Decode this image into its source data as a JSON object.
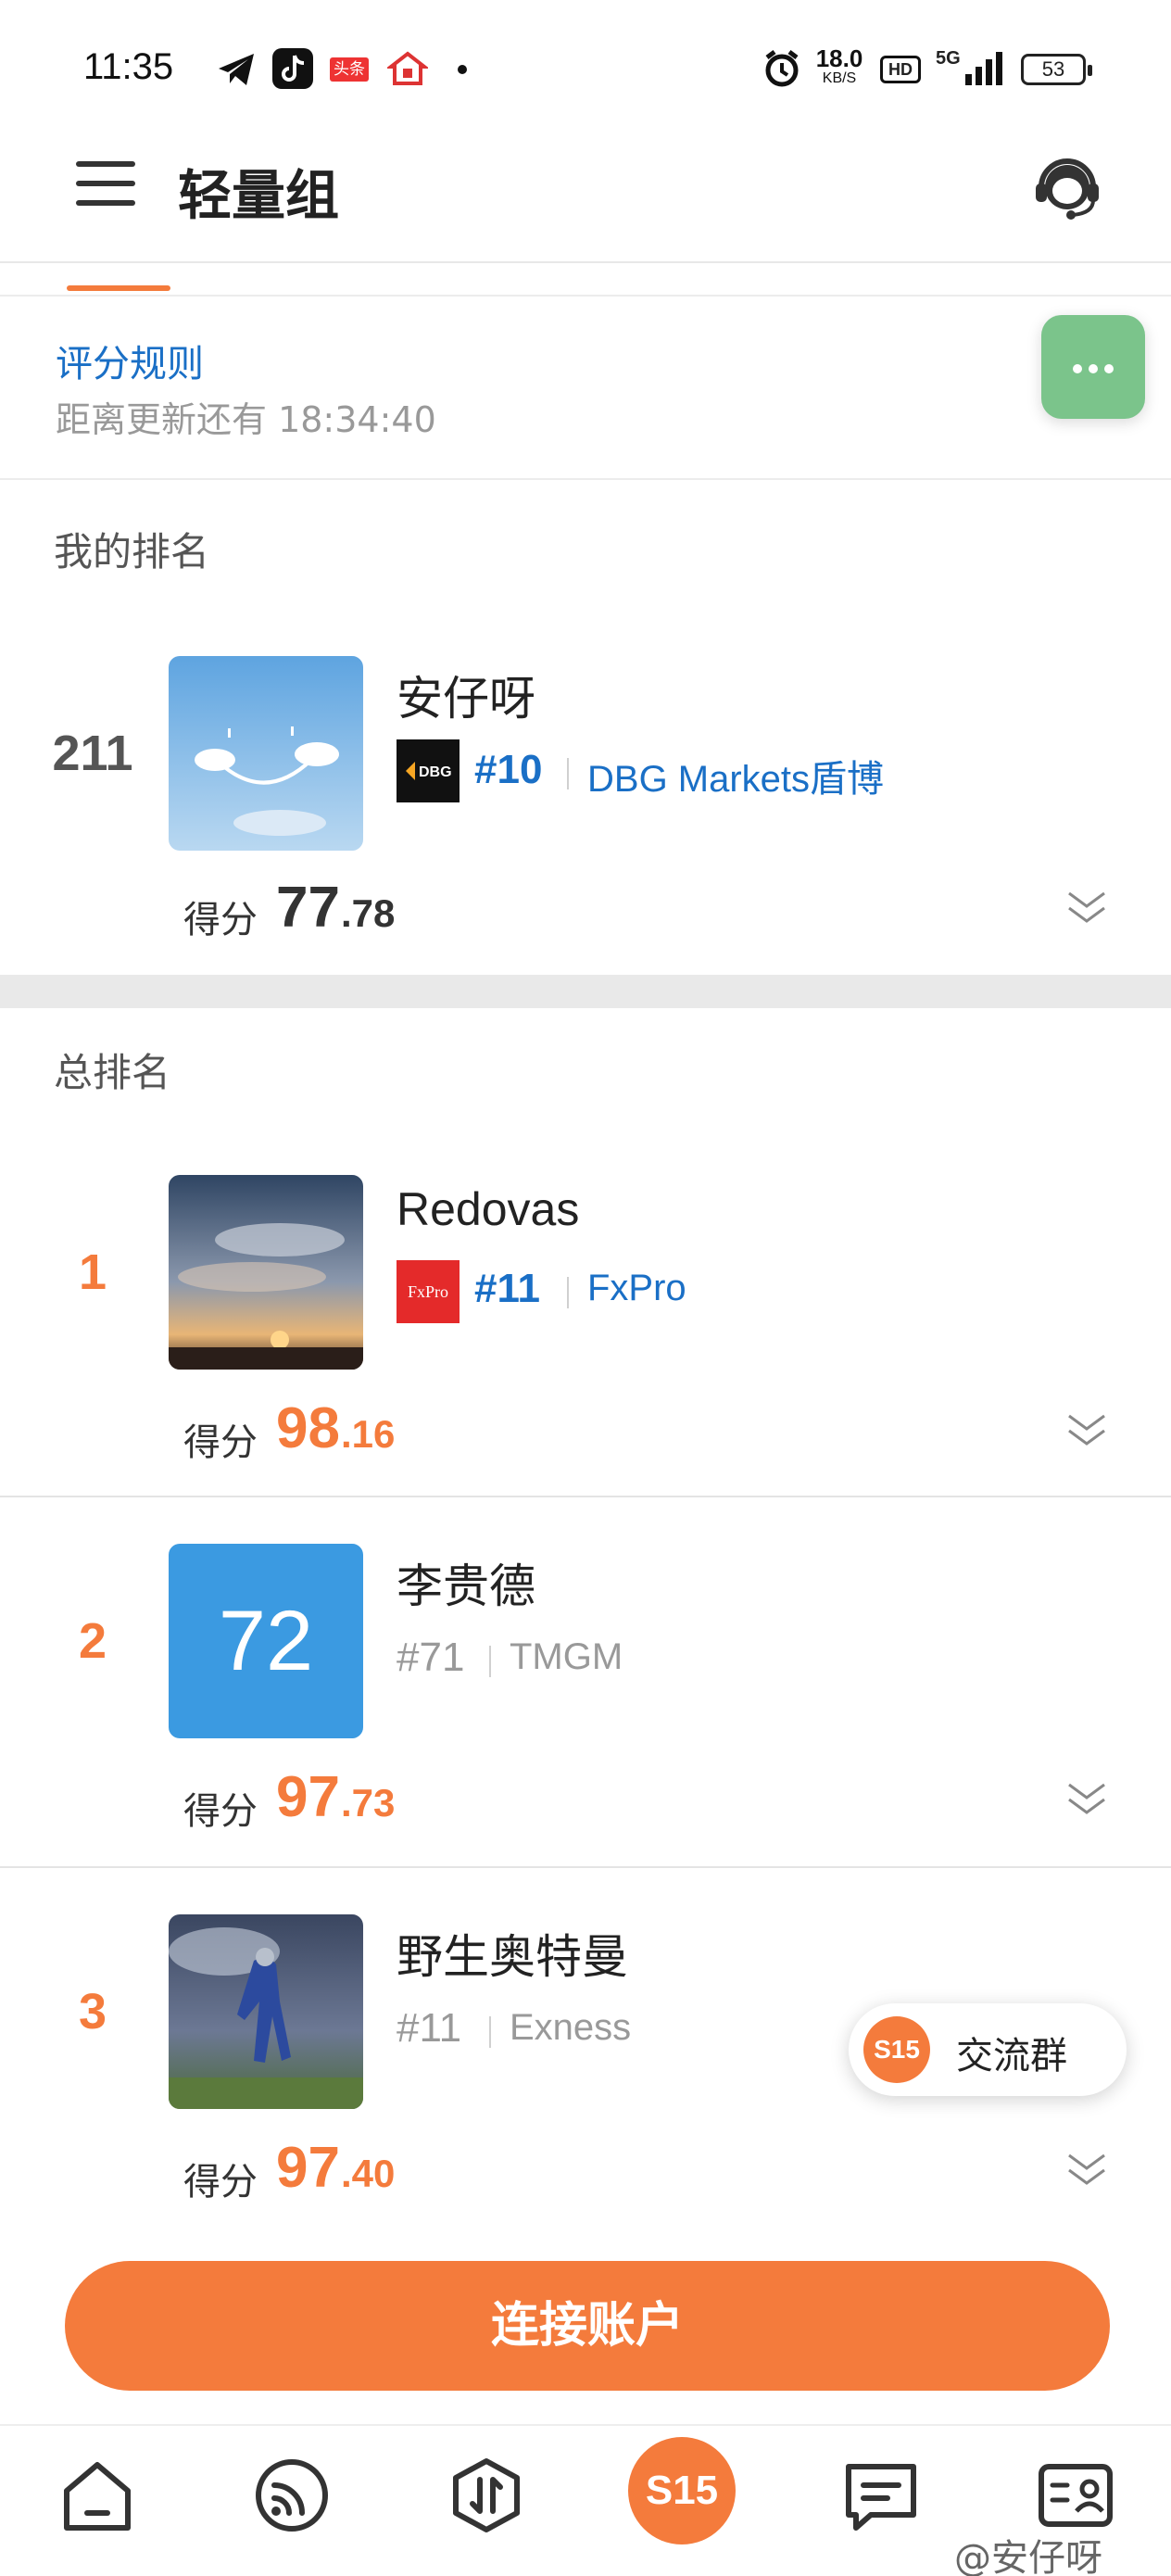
{
  "status_bar": {
    "time": "11:35",
    "notif_toutiao": "头条",
    "net_speed": "18.0",
    "net_unit": "KB/S",
    "hd_label": "HD",
    "signal_label": "5G",
    "battery": "53"
  },
  "header": {
    "title": "轻量组",
    "menu_icon": "hamburger-menu-icon",
    "support_icon": "customer-service-icon"
  },
  "rules": {
    "link_label": "评分规则",
    "countdown": "距离更新还有 18:34:40"
  },
  "my_rank": {
    "section_title": "我的排名",
    "rank": "211",
    "name": "安仔呀",
    "broker_rank": "#10",
    "broker_name": "DBG Markets盾博",
    "score_label": "得分",
    "score_int": "77",
    "score_dec": ".78"
  },
  "overall": {
    "section_title": "总排名",
    "rows": [
      {
        "rank": "1",
        "name": "Redovas",
        "broker_rank": "#11",
        "broker_name": "FxPro",
        "score_label": "得分",
        "score_int": "98",
        "score_dec": ".16",
        "logo_text": "FxPro"
      },
      {
        "rank": "2",
        "name": "李贵德",
        "avatar_text": "72",
        "broker_rank": "#71",
        "broker_name": "TMGM",
        "score_label": "得分",
        "score_int": "97",
        "score_dec": ".73"
      },
      {
        "rank": "3",
        "name": "野生奥特曼",
        "broker_rank": "#11",
        "broker_name": "Exness",
        "score_label": "得分",
        "score_int": "97",
        "score_dec": ".40"
      }
    ]
  },
  "group_chip": {
    "logo": "S15",
    "label": "交流群"
  },
  "connect_button": "连接账户",
  "bottom_nav": {
    "center_label": "S15",
    "icons": [
      "home-icon",
      "feed-icon",
      "trade-icon",
      "s15-icon",
      "message-icon",
      "profile-card-icon"
    ]
  },
  "watermark": "@安仔呀",
  "colors": {
    "accent": "#f47b3c",
    "link": "#1a6fc6",
    "more_button": "#7bc48b"
  }
}
